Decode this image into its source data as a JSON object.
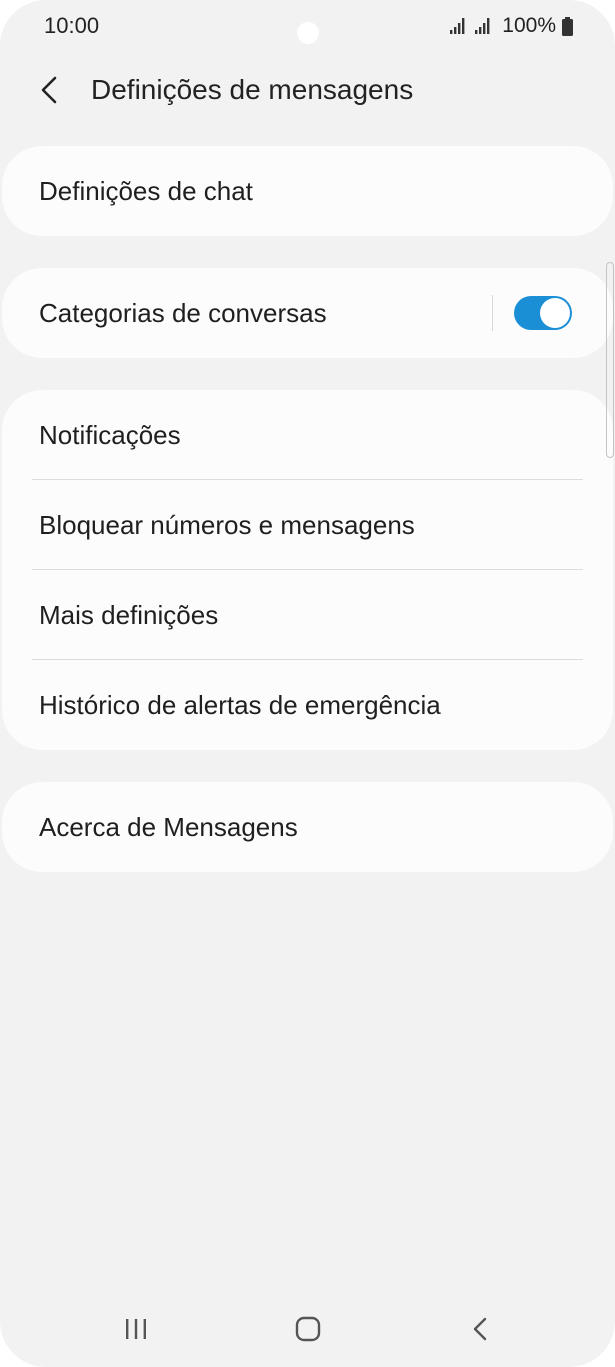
{
  "status_bar": {
    "time": "10:00",
    "battery_percent": "100%",
    "icons": [
      "signal-icon",
      "signal-icon",
      "battery-icon"
    ]
  },
  "header": {
    "back_icon": "chevron-left-icon",
    "title": "Definições de mensagens"
  },
  "settings": {
    "chat": {
      "label": "Definições de chat"
    },
    "conversation_categories": {
      "label": "Categorias de conversas",
      "enabled": true
    },
    "group_items": [
      {
        "label": "Notificações"
      },
      {
        "label": "Bloquear números e mensagens"
      },
      {
        "label": "Mais definições"
      },
      {
        "label": "Histórico de alertas de emergência"
      }
    ],
    "about": {
      "label": "Acerca de Mensagens"
    }
  },
  "nav_bar": {
    "icons": [
      "recent-apps-icon",
      "home-icon",
      "back-icon"
    ]
  },
  "colors": {
    "background": "#f2f2f2",
    "card": "#fcfcfc",
    "toggle_on": "#1a8fd6",
    "text": "#1f1f1f"
  }
}
